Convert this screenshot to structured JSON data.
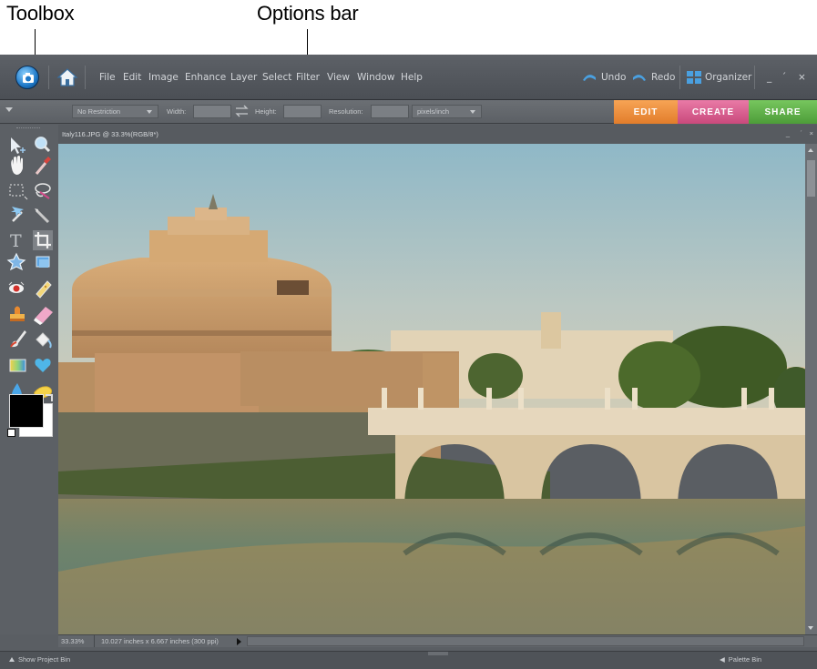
{
  "callouts": {
    "toolbox": "Toolbox",
    "options_bar": "Options bar"
  },
  "menu": {
    "items": [
      "File",
      "Edit",
      "Image",
      "Enhance",
      "Layer",
      "Select",
      "Filter",
      "View",
      "Window",
      "Help"
    ],
    "undo": "Undo",
    "redo": "Redo",
    "organizer": "Organizer",
    "window_controls": [
      "_",
      "´",
      "×"
    ]
  },
  "options_bar": {
    "aspect_value": "No Restriction",
    "width_label": "Width:",
    "height_label": "Height:",
    "resolution_label": "Resolution:",
    "resolution_unit": "pixels/inch"
  },
  "mode_tabs": [
    {
      "label": "EDIT",
      "color": "#f08f3a"
    },
    {
      "label": "CREATE",
      "color": "#d95a8f"
    },
    {
      "label": "SHARE",
      "color": "#5cae45"
    }
  ],
  "document": {
    "title": "Italy116.JPG @ 33.3%(RGB/8*)",
    "zoom": "33.33%",
    "doc_size": "10.027 inches x 6.667 inches (300 ppi)"
  },
  "bottom": {
    "project_bin": "Show Project Bin",
    "palette_bin": "Palette Bin"
  },
  "tools": [
    "move-tool-icon",
    "zoom-tool-icon",
    "hand-tool-icon",
    "eyedropper-tool-icon",
    "marquee-tool-icon",
    "lasso-tool-icon",
    "magic-wand-tool-icon",
    "selection-brush-tool-icon",
    "type-tool-icon",
    "crop-tool-icon",
    "cookie-cutter-tool-icon",
    "straighten-tool-icon",
    "red-eye-tool-icon",
    "spot-healing-tool-icon",
    "clone-stamp-tool-icon",
    "eraser-tool-icon",
    "brush-tool-icon",
    "paint-bucket-tool-icon",
    "gradient-tool-icon",
    "shape-tool-icon",
    "blur-tool-icon",
    "sponge-tool-icon"
  ],
  "colors": {
    "foreground": "#000000",
    "background": "#ffffff",
    "app_bg": "#5a5e63"
  }
}
